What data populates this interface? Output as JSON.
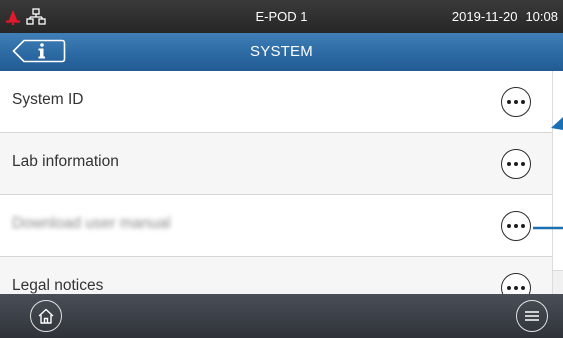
{
  "status_bar": {
    "device_name": "E-POD 1",
    "date": "2019-11-20",
    "time": "10:08",
    "icons": [
      "alarm-bell-icon",
      "network-icon"
    ],
    "alert_color": "#e0192d"
  },
  "header": {
    "title": "SYSTEM",
    "back_icon": "info-back-icon",
    "accent_color": "#2c6aa4"
  },
  "menu": {
    "items": [
      {
        "label": "System ID",
        "action_icon": "more-options-icon"
      },
      {
        "label": "Lab information",
        "action_icon": "more-options-icon"
      },
      {
        "label": "Download user manual",
        "action_icon": "more-options-icon"
      },
      {
        "label": "Legal notices",
        "action_icon": "more-options-icon"
      }
    ]
  },
  "footer": {
    "home_icon": "home-icon",
    "menu_icon": "hamburger-menu-icon"
  },
  "callout_color": "#1b6fb3"
}
